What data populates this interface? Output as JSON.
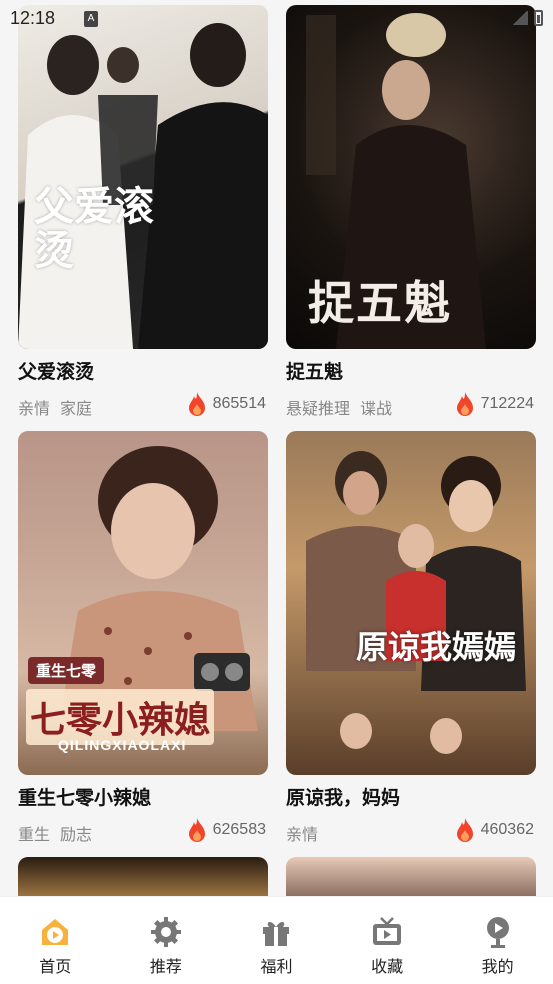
{
  "status": {
    "time": "12:18",
    "badge": "A"
  },
  "cards": [
    {
      "title": "父爱滚烫",
      "tags": [
        "亲情",
        "家庭"
      ],
      "heat": "865514",
      "poster_text": "父爱滚烫",
      "colors": [
        "#e8e4dc",
        "#b7b0a6"
      ]
    },
    {
      "title": "捉五魁",
      "tags": [
        "悬疑推理",
        "谍战"
      ],
      "heat": "712224",
      "poster_text": "捉五魁",
      "colors": [
        "#2a2420",
        "#0e0b0a"
      ]
    },
    {
      "title": "重生七零小辣媳",
      "tags": [
        "重生",
        "励志"
      ],
      "heat": "626583",
      "poster_text": "七零小辣媳",
      "poster_subtext": "重生七零",
      "poster_latin": "QILINGXIAOLAXI",
      "colors": [
        "#c9a897",
        "#9b6f5e"
      ]
    },
    {
      "title": "原谅我，妈妈",
      "tags": [
        "亲情"
      ],
      "heat": "460362",
      "poster_text": "原谅我嫣嫣",
      "colors": [
        "#8a6a4a",
        "#3d2b1e"
      ]
    },
    {
      "title": "",
      "tags": [],
      "heat": "",
      "colors": [
        "#d9a25a",
        "#3b2a1a"
      ]
    },
    {
      "title": "",
      "tags": [],
      "heat": "",
      "colors": [
        "#c9a897",
        "#5d4036"
      ]
    }
  ],
  "tabs": [
    {
      "label": "首页",
      "icon": "home-play-icon",
      "active": true
    },
    {
      "label": "推荐",
      "icon": "gear-icon",
      "active": false
    },
    {
      "label": "福利",
      "icon": "gift-icon",
      "active": false
    },
    {
      "label": "收藏",
      "icon": "tv-icon",
      "active": false
    },
    {
      "label": "我的",
      "icon": "user-icon",
      "active": false
    }
  ],
  "accent": "#f5a623"
}
